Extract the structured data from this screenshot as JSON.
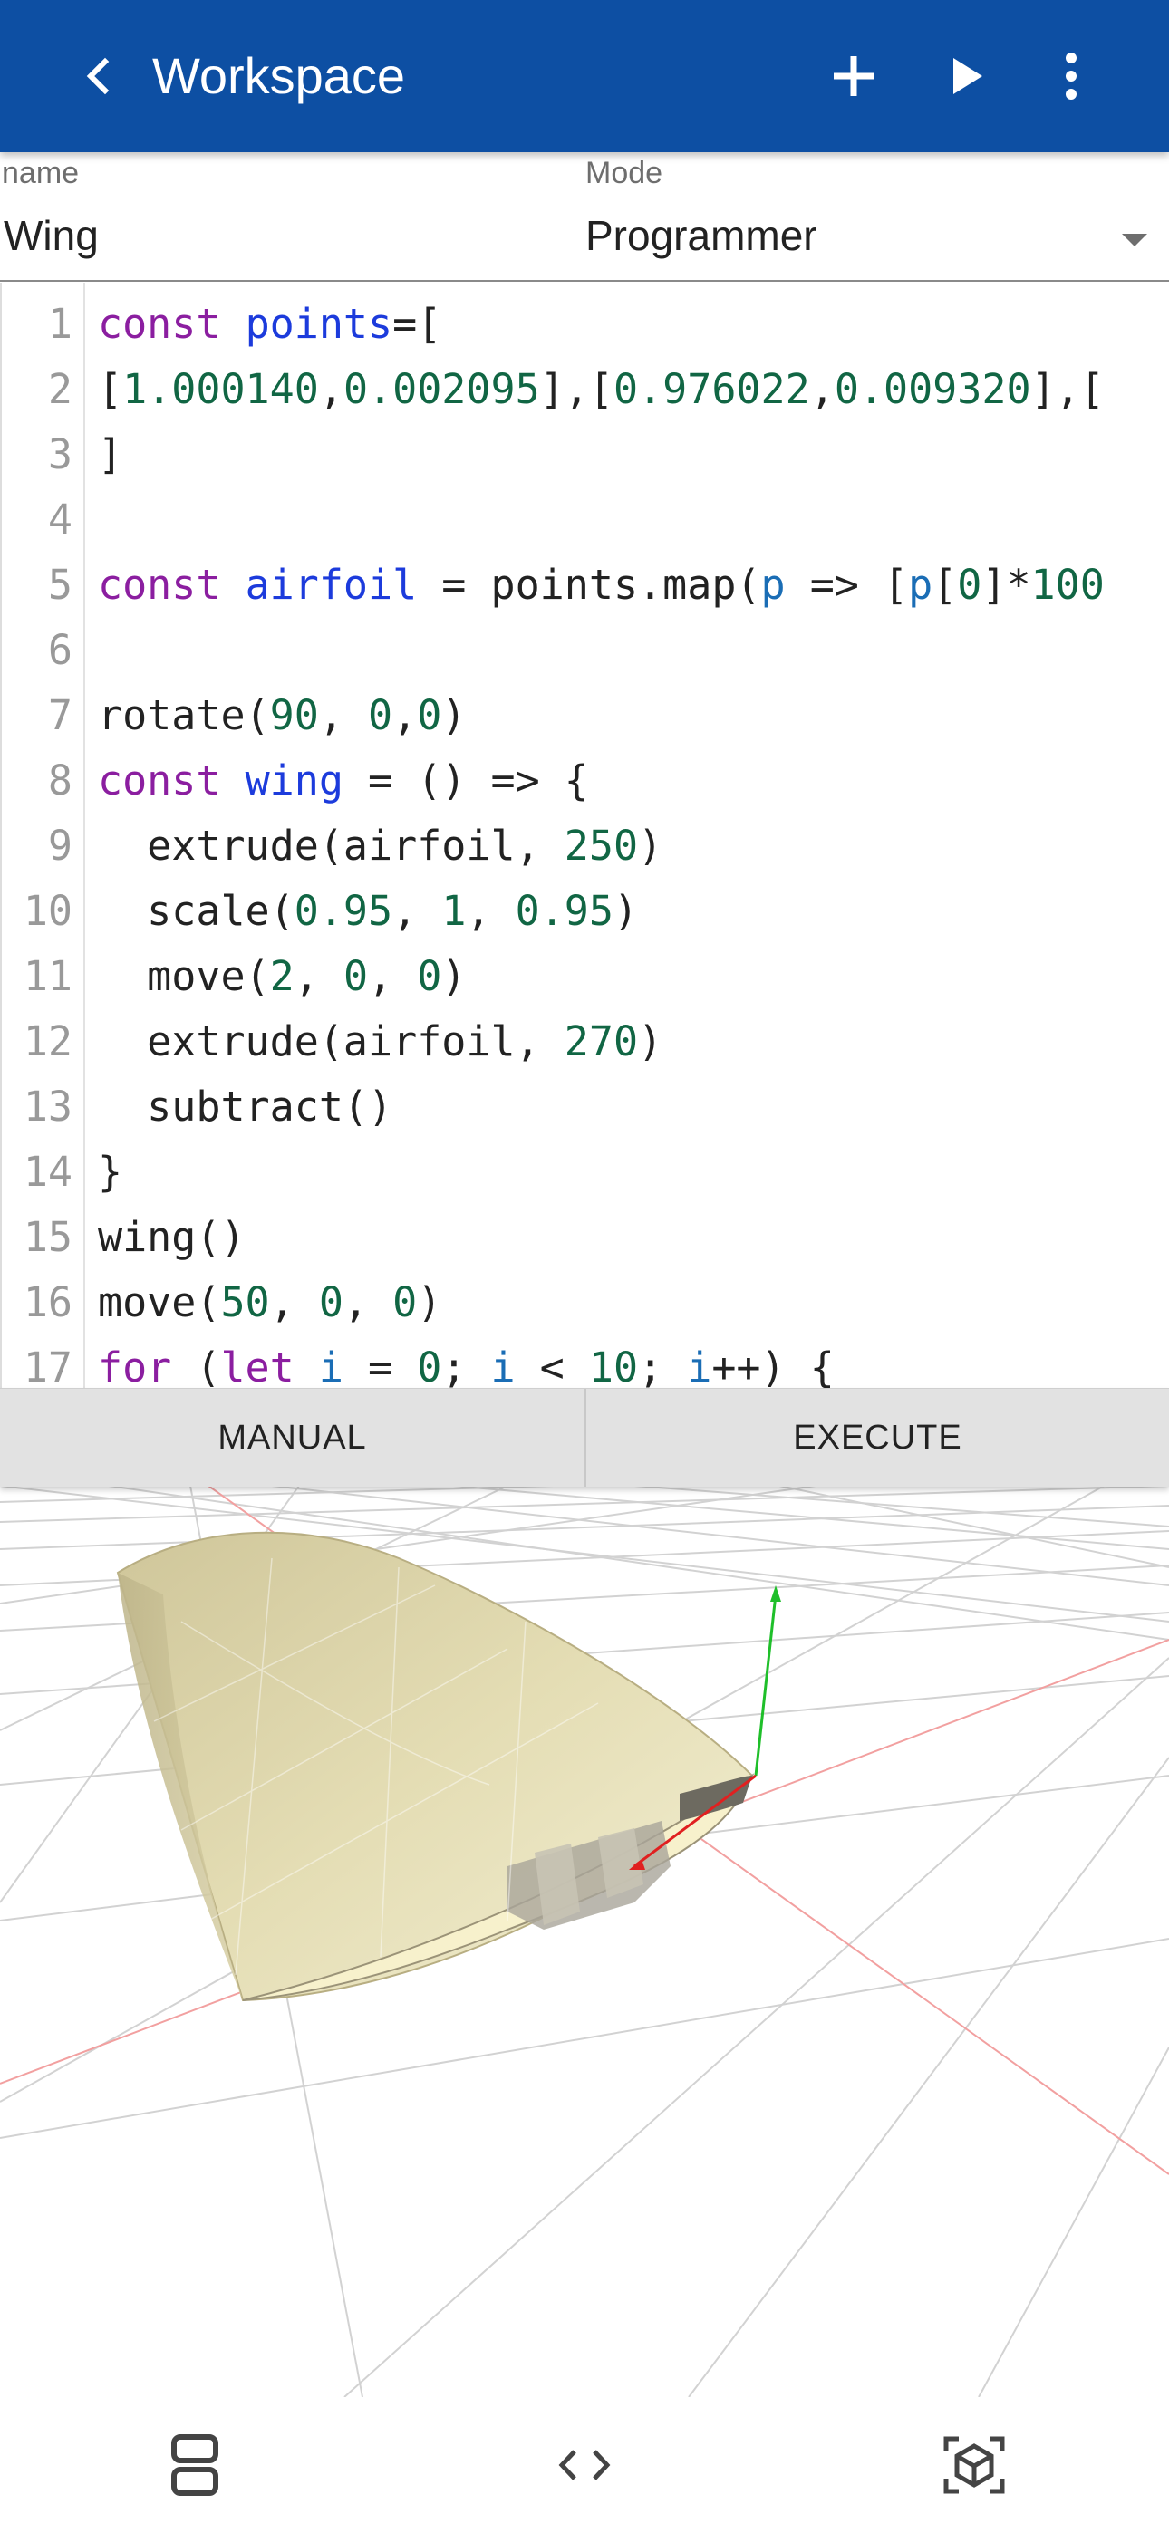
{
  "appbar": {
    "title": "Workspace",
    "back_icon": "chevron-left-icon",
    "actions": [
      "plus-icon",
      "play-icon",
      "more-vertical-icon"
    ],
    "color": "#0d4fa3"
  },
  "fields": {
    "name_label": "name",
    "name_value": "Wing",
    "mode_label": "Mode",
    "mode_value": "Programmer"
  },
  "editor": {
    "lines": [
      {
        "n": "1",
        "t": [
          [
            "kw",
            "const "
          ],
          [
            "def",
            "points"
          ],
          [
            "",
            "=["
          ]
        ]
      },
      {
        "n": "2",
        "t": [
          [
            "",
            "["
          ],
          [
            "num",
            "1.000140"
          ],
          [
            "",
            ","
          ],
          [
            "num",
            "0.002095"
          ],
          [
            "",
            "],["
          ],
          [
            "num",
            "0.976022"
          ],
          [
            "",
            ","
          ],
          [
            "num",
            "0.009320"
          ],
          [
            "",
            "],["
          ]
        ]
      },
      {
        "n": "3",
        "t": [
          [
            "",
            "]"
          ]
        ]
      },
      {
        "n": "4",
        "t": []
      },
      {
        "n": "5",
        "t": [
          [
            "kw",
            "const "
          ],
          [
            "def",
            "airfoil"
          ],
          [
            "",
            " = points.map("
          ],
          [
            "var2",
            "p"
          ],
          [
            "",
            " => ["
          ],
          [
            "var2",
            "p"
          ],
          [
            "",
            "["
          ],
          [
            "num",
            "0"
          ],
          [
            "",
            "]*"
          ],
          [
            "num",
            "100"
          ]
        ]
      },
      {
        "n": "6",
        "t": []
      },
      {
        "n": "7",
        "t": [
          [
            "",
            "rotate("
          ],
          [
            "num",
            "90"
          ],
          [
            "",
            ", "
          ],
          [
            "num",
            "0"
          ],
          [
            "",
            ","
          ],
          [
            "num",
            "0"
          ],
          [
            "",
            ")"
          ]
        ]
      },
      {
        "n": "8",
        "t": [
          [
            "kw",
            "const "
          ],
          [
            "def",
            "wing"
          ],
          [
            "",
            " = () => {"
          ]
        ]
      },
      {
        "n": "9",
        "t": [
          [
            "",
            "  extrude(airfoil, "
          ],
          [
            "num",
            "250"
          ],
          [
            "",
            ")"
          ]
        ]
      },
      {
        "n": "10",
        "t": [
          [
            "",
            "  scale("
          ],
          [
            "num",
            "0.95"
          ],
          [
            "",
            ", "
          ],
          [
            "num",
            "1"
          ],
          [
            "",
            ", "
          ],
          [
            "num",
            "0.95"
          ],
          [
            "",
            ")"
          ]
        ]
      },
      {
        "n": "11",
        "t": [
          [
            "",
            "  move("
          ],
          [
            "num",
            "2"
          ],
          [
            "",
            ", "
          ],
          [
            "num",
            "0"
          ],
          [
            "",
            ", "
          ],
          [
            "num",
            "0"
          ],
          [
            "",
            ")"
          ]
        ]
      },
      {
        "n": "12",
        "t": [
          [
            "",
            "  extrude(airfoil, "
          ],
          [
            "num",
            "270"
          ],
          [
            "",
            ")"
          ]
        ]
      },
      {
        "n": "13",
        "t": [
          [
            "",
            "  subtract()"
          ]
        ]
      },
      {
        "n": "14",
        "t": [
          [
            "",
            "}"
          ]
        ]
      },
      {
        "n": "15",
        "t": [
          [
            "",
            "wing()"
          ]
        ]
      },
      {
        "n": "16",
        "t": [
          [
            "",
            "move("
          ],
          [
            "num",
            "50"
          ],
          [
            "",
            ", "
          ],
          [
            "num",
            "0"
          ],
          [
            "",
            ", "
          ],
          [
            "num",
            "0"
          ],
          [
            "",
            ")"
          ]
        ]
      },
      {
        "n": "17",
        "t": [
          [
            "kw",
            "for"
          ],
          [
            "",
            " ("
          ],
          [
            "kw",
            "let "
          ],
          [
            "var2",
            "i"
          ],
          [
            "",
            " = "
          ],
          [
            "num",
            "0"
          ],
          [
            "",
            "; "
          ],
          [
            "var2",
            "i"
          ],
          [
            "",
            " < "
          ],
          [
            "num",
            "10"
          ],
          [
            "",
            "; "
          ],
          [
            "var2",
            "i"
          ],
          [
            "",
            "++) {"
          ]
        ]
      }
    ]
  },
  "buttons": {
    "manual": "MANUAL",
    "execute": "EXECUTE"
  },
  "bottom_nav": {
    "items": [
      "split-view-icon",
      "code-icon",
      "3d-view-icon"
    ]
  }
}
